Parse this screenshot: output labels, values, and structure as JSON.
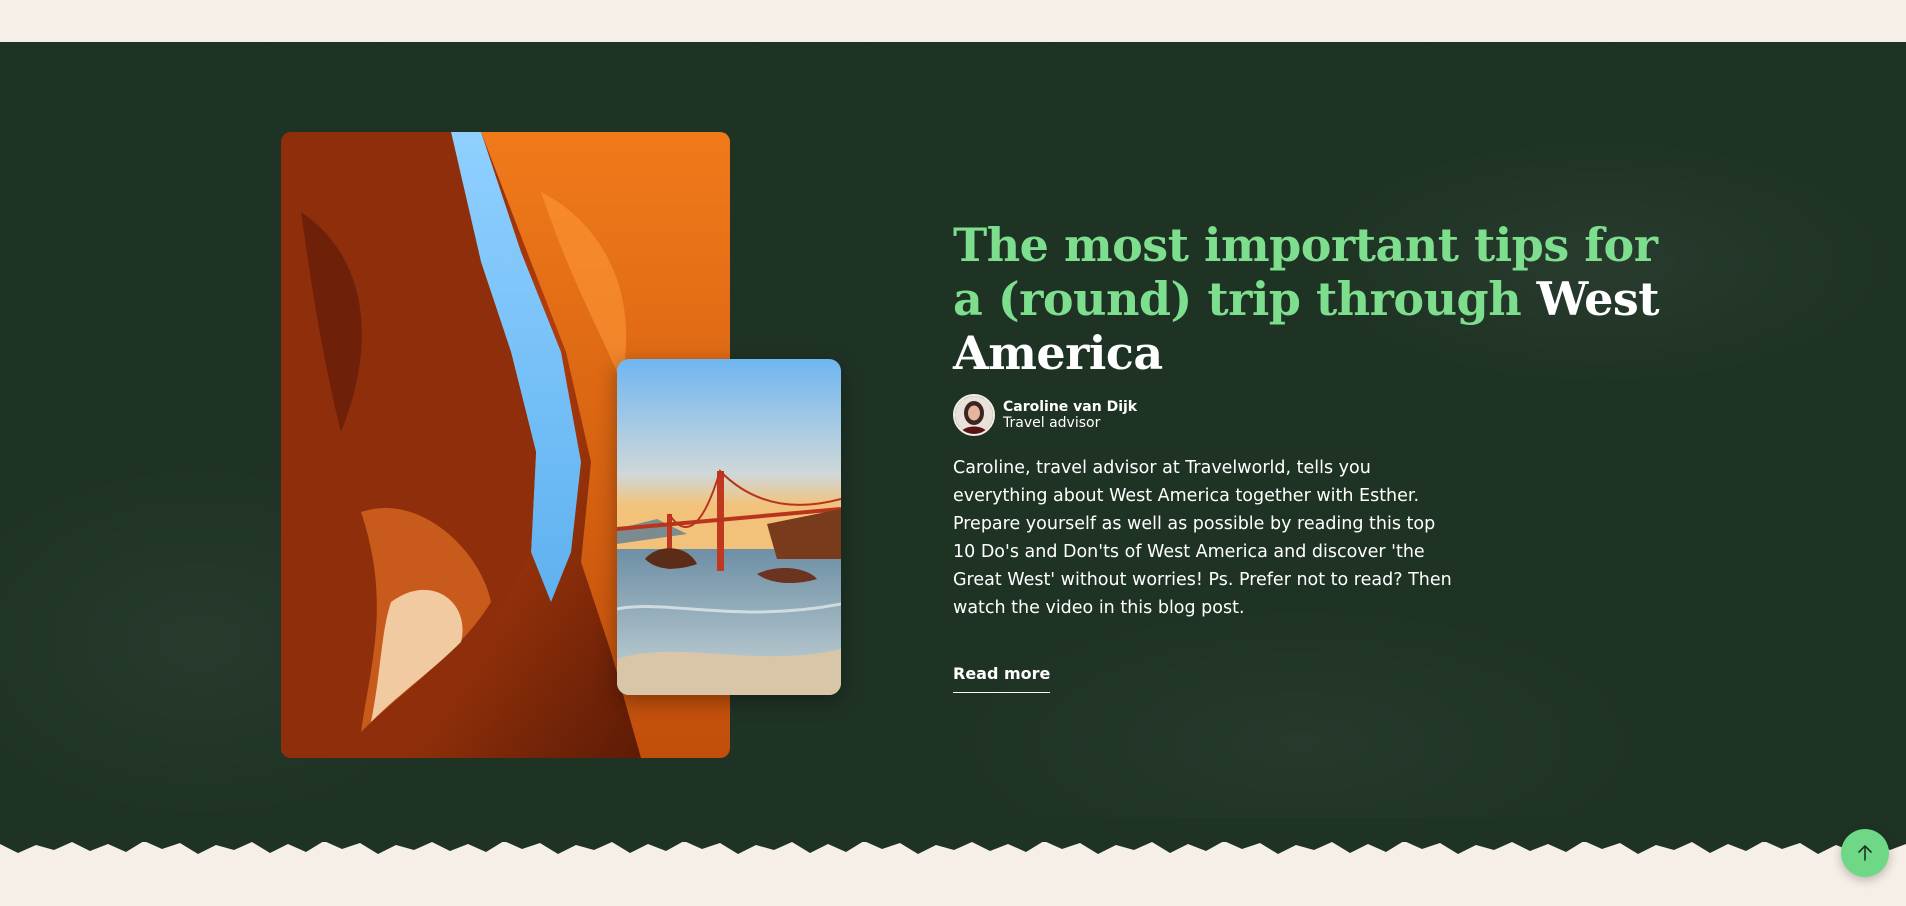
{
  "article": {
    "title_part1": "The most important tips for a (round) trip through ",
    "title_highlight": "West America",
    "author_name": "Caroline van Dijk",
    "author_role": "Travel advisor",
    "description": "Caroline, travel advisor at Travelworld, tells you everything about West America together with Esther. Prepare yourself as well as possible by reading this top 10 Do's and Don'ts of West America and discover 'the Great West' without worries! Ps. Prefer not to read? Then watch the video in this blog post.",
    "read_more_label": "Read more"
  },
  "icons": {
    "scroll_top": "arrow-up-icon"
  },
  "colors": {
    "band": "#1f3325",
    "page": "#f6efe7",
    "title_green": "#7ddf8d",
    "accent_button": "#6fd886"
  }
}
